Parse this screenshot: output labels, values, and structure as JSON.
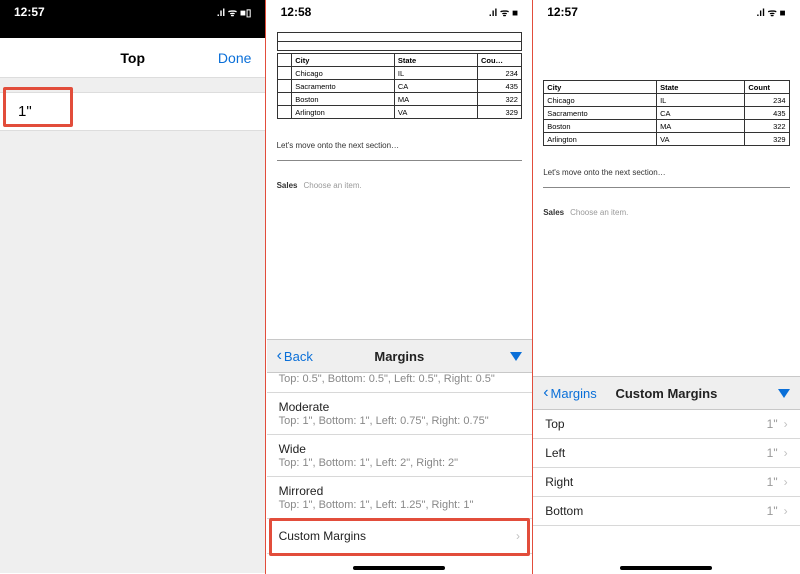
{
  "phone1": {
    "time": "12:58",
    "signal_icons": ".ıl ᯤ ■",
    "table": {
      "headers": [
        "City",
        "State",
        "Cou…"
      ],
      "rows": [
        [
          "Chicago",
          "IL",
          "234"
        ],
        [
          "Sacramento",
          "CA",
          "435"
        ],
        [
          "Boston",
          "MA",
          "322"
        ],
        [
          "Arlington",
          "VA",
          "329"
        ]
      ]
    },
    "doc_text": "Let's move onto the next section…",
    "sales_label": "Sales",
    "sales_choose": "Choose an item.",
    "panel": {
      "back": "Back",
      "title": "Margins",
      "truncated": "Top: 0.5\", Bottom: 0.5\", Left: 0.5\", Right: 0.5\"",
      "items": [
        {
          "title": "Moderate",
          "sub": "Top: 1\", Bottom: 1\", Left: 0.75\", Right: 0.75\""
        },
        {
          "title": "Wide",
          "sub": "Top: 1\", Bottom: 1\", Left: 2\", Right: 2\""
        },
        {
          "title": "Mirrored",
          "sub": "Top: 1\", Bottom: 1\", Left: 1.25\", Right: 1\""
        }
      ],
      "custom": "Custom Margins"
    }
  },
  "phone2": {
    "time": "12:57",
    "signal_icons": ".ıl ᯤ ■",
    "table": {
      "headers": [
        "City",
        "State",
        "Count"
      ],
      "rows": [
        [
          "Chicago",
          "IL",
          "234"
        ],
        [
          "Sacramento",
          "CA",
          "435"
        ],
        [
          "Boston",
          "MA",
          "322"
        ],
        [
          "Arlington",
          "VA",
          "329"
        ]
      ]
    },
    "doc_text": "Let's move onto the next section…",
    "sales_label": "Sales",
    "sales_choose": "Choose an item.",
    "panel": {
      "back": "Margins",
      "title": "Custom Margins",
      "rows": [
        {
          "label": "Top",
          "value": "1\""
        },
        {
          "label": "Left",
          "value": "1\""
        },
        {
          "label": "Right",
          "value": "1\""
        },
        {
          "label": "Bottom",
          "value": "1\""
        }
      ]
    }
  },
  "phone3": {
    "time": "12:57",
    "signal_icons": ".ıl ᯤ ■▯",
    "title": "Top",
    "done": "Done",
    "value": "1\""
  },
  "watermark": ""
}
